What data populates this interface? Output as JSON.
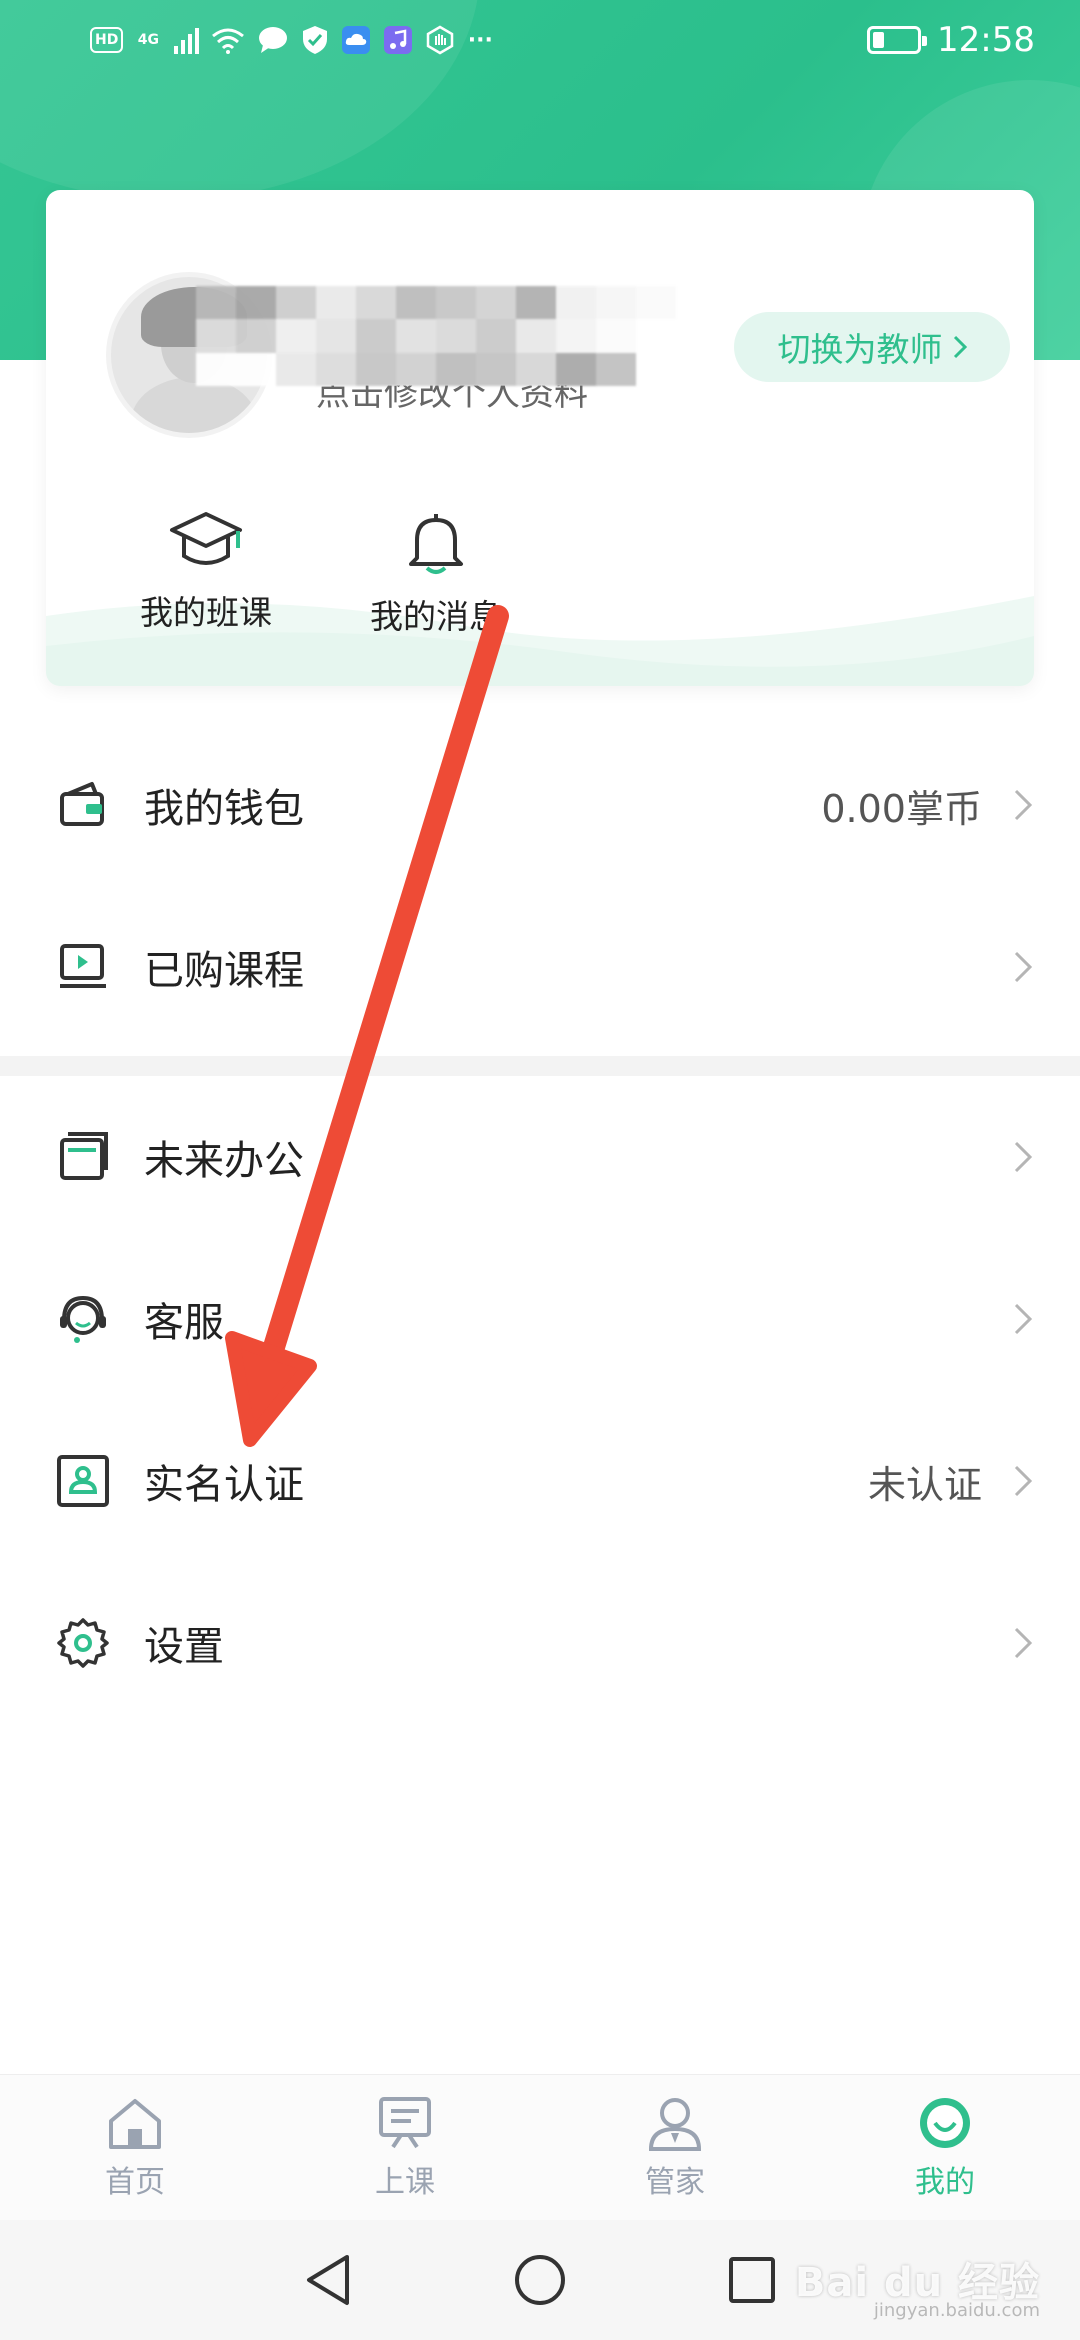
{
  "status_bar": {
    "icons": [
      "HD",
      "4G",
      "signal-icon",
      "wifi-icon",
      "message-icon",
      "shield-icon",
      "cloud-icon",
      "music-icon",
      "hand-icon",
      "more-icon"
    ],
    "hd_label": "HD",
    "network_label": "4G",
    "more_label": "···",
    "battery_level": 0.25,
    "time": "12:58"
  },
  "profile": {
    "edit_hint": "点击修改个人资料",
    "switch_button": "切换为教师",
    "shortcuts": [
      {
        "label": "我的班课",
        "icon": "graduation-cap-icon"
      },
      {
        "label": "我的消息",
        "icon": "bell-icon"
      }
    ]
  },
  "menu_group_1": [
    {
      "label": "我的钱包",
      "value": "0.00掌币",
      "icon": "wallet-icon"
    },
    {
      "label": "已购课程",
      "value": "",
      "icon": "video-course-icon"
    }
  ],
  "menu_group_2": [
    {
      "label": "未来办公",
      "value": "",
      "icon": "office-icon"
    },
    {
      "label": "客服",
      "value": "",
      "icon": "customer-service-icon"
    },
    {
      "label": "实名认证",
      "value": "未认证",
      "icon": "id-card-icon"
    },
    {
      "label": "设置",
      "value": "",
      "icon": "gear-icon"
    }
  ],
  "tabbar": [
    {
      "label": "首页",
      "icon": "home-icon",
      "active": false
    },
    {
      "label": "上课",
      "icon": "class-board-icon",
      "active": false
    },
    {
      "label": "管家",
      "icon": "butler-icon",
      "active": false
    },
    {
      "label": "我的",
      "icon": "me-icon",
      "active": true
    }
  ],
  "watermark": {
    "text": "Bai du 经验",
    "sub": "jingyan.baidu.com"
  },
  "colors": {
    "accent": "#2fbf8d",
    "arrow": "#ee4b36",
    "tab_inactive": "#9aa3b1"
  }
}
